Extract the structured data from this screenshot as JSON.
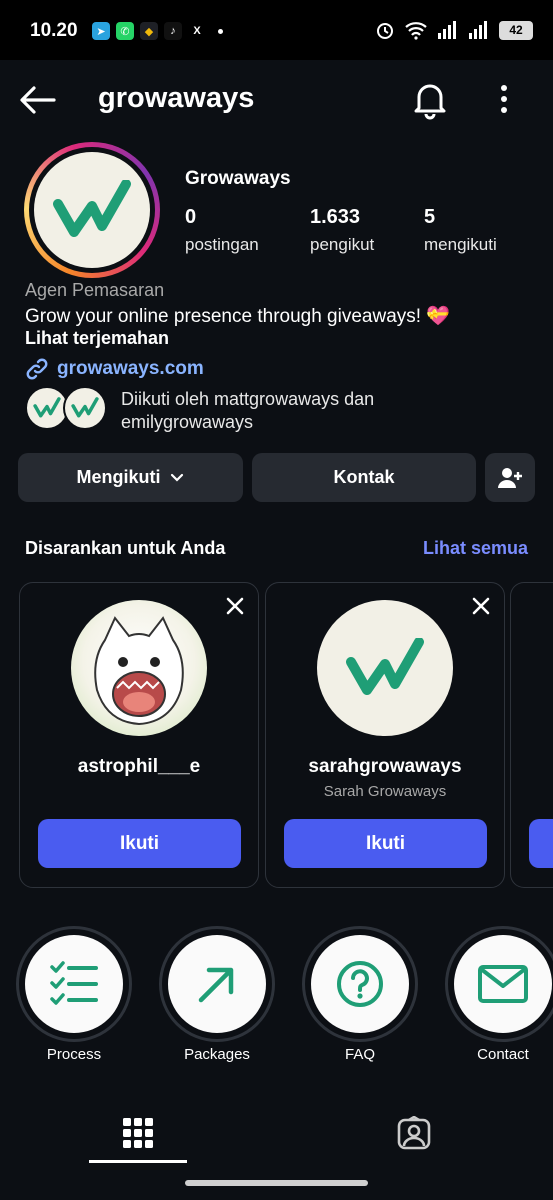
{
  "status_bar": {
    "time": "10.20",
    "battery": "42",
    "apps": [
      {
        "icon": "telegram-icon",
        "glyph": "➤",
        "color": "#2aa3df"
      },
      {
        "icon": "whatsapp-icon",
        "glyph": "✆",
        "color": "#25d366"
      },
      {
        "icon": "binance-icon",
        "glyph": "◆",
        "color": "#1e2026"
      },
      {
        "icon": "tiktok-icon",
        "glyph": "♪",
        "color": "#111"
      },
      {
        "icon": "x-icon",
        "glyph": "𝕏",
        "color": "#000"
      }
    ]
  },
  "header": {
    "username": "growaways"
  },
  "profile": {
    "display_name": "Growaways",
    "stats": [
      {
        "value": "0",
        "label": "postingan"
      },
      {
        "value": "1.633",
        "label": "pengikut"
      },
      {
        "value": "5",
        "label": "mengikuti"
      }
    ],
    "category": "Agen Pemasaran",
    "bio": "Grow your online presence through giveaways! 💝",
    "translate": "Lihat terjemahan",
    "website": "growaways.com",
    "followed_by": "Diikuti oleh mattgrowaways dan emilygrowaways"
  },
  "actions": {
    "following": "Mengikuti",
    "contact": "Kontak"
  },
  "suggested": {
    "title": "Disarankan untuk Anda",
    "see_all": "Lihat semua",
    "cards": [
      {
        "username": "astrophil___e",
        "subtitle": "",
        "follow": "Ikuti"
      },
      {
        "username": "sarahgrowaways",
        "subtitle": "Sarah Growaways",
        "follow": "Ikuti"
      }
    ]
  },
  "highlights": [
    {
      "label": "Process",
      "icon": "checklist-icon"
    },
    {
      "label": "Packages",
      "icon": "arrow-up-right-icon"
    },
    {
      "label": "FAQ",
      "icon": "question-icon"
    },
    {
      "label": "Contact",
      "icon": "mail-icon"
    }
  ],
  "tabs": [
    {
      "icon": "grid-icon",
      "active": true
    },
    {
      "icon": "tagged-icon",
      "active": false
    }
  ],
  "colors": {
    "brand_green": "#1f9e76",
    "accent_blue": "#4a5cf0",
    "link_blue": "#8ab4ff"
  }
}
